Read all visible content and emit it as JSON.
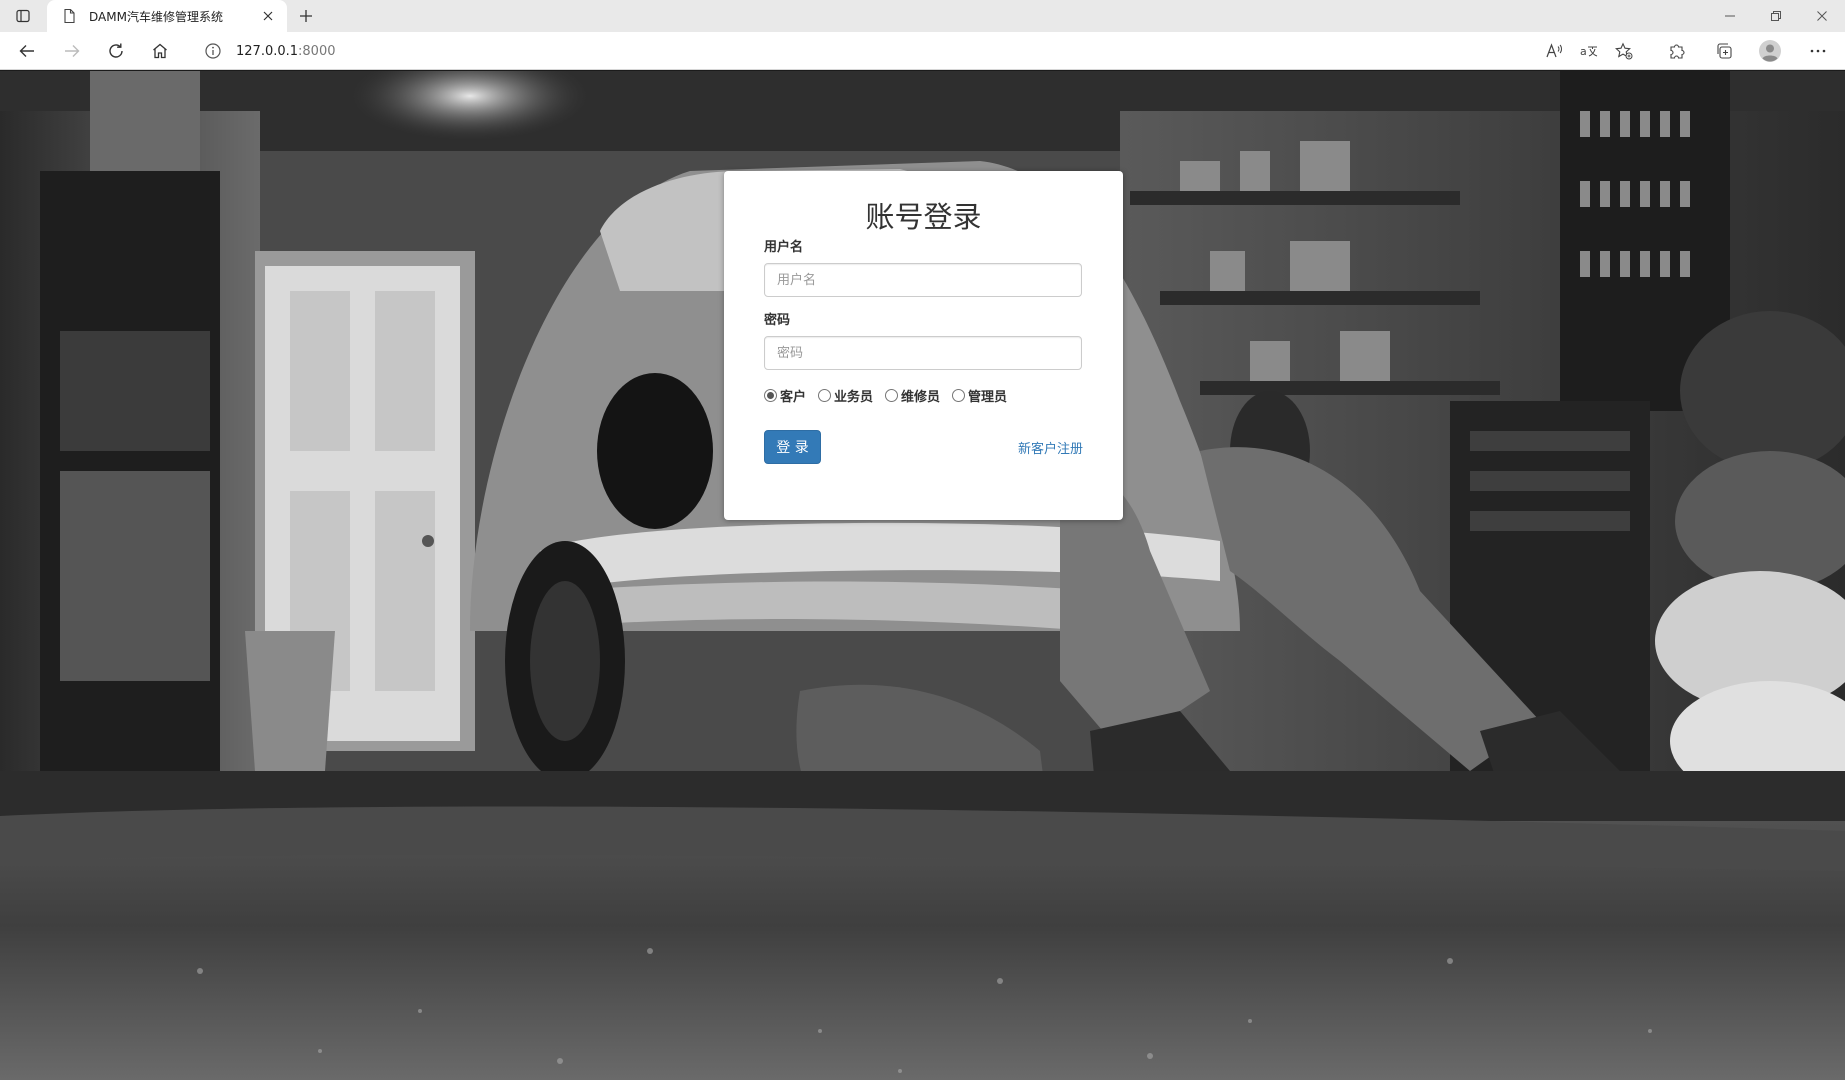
{
  "browser": {
    "tab_title": "DAMM汽车维修管理系统",
    "url_host": "127.0.0.1",
    "url_port": ":8000"
  },
  "login": {
    "title": "账号登录",
    "username_label": "用户名",
    "username_placeholder": "用户名",
    "password_label": "密码",
    "password_placeholder": "密码",
    "roles": [
      {
        "label": "客户",
        "checked": true
      },
      {
        "label": "业务员",
        "checked": false
      },
      {
        "label": "维修员",
        "checked": false
      },
      {
        "label": "管理员",
        "checked": false
      }
    ],
    "login_button": "登 录",
    "register_link": "新客户注册"
  },
  "colors": {
    "primary": "#337ab7",
    "tabbar_bg": "#e9e9e9"
  }
}
